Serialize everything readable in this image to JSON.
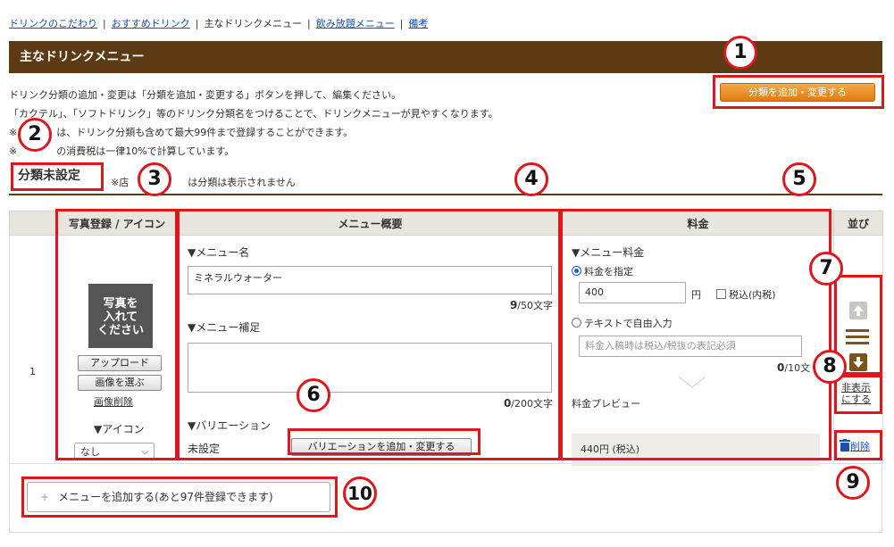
{
  "breadcrumb": {
    "items": [
      "ドリンクのこだわり",
      "おすすめドリンク",
      "主なドリンクメニュー",
      "飲み放題メニュー",
      "備考"
    ],
    "separator": "|"
  },
  "page_title": "主なドリンクメニュー",
  "description": {
    "line1": "ドリンク分類の追加・変更は「分類を追加・変更する」ボタンを押して、編集ください。",
    "line2": "「カクテル」、「ソフトドリンク」等のドリンク分類名をつけることで、ドリンクメニューが見やすくなります。",
    "line3": "※　　　　は、ドリンク分類も含めて最大99件まで登録することができます。",
    "line4": "※　　　　の消費税は一律10%で計算しています。"
  },
  "add_category_button": "分類を追加・変更する",
  "category": {
    "label": "分類未設定",
    "note": "※店　　　　　　は分類は表示されません"
  },
  "table": {
    "headers": [
      "",
      "写真登録 / アイコン",
      "メニュー概要",
      "料金",
      "並び"
    ],
    "row": {
      "number": "1",
      "photo": {
        "placeholder_line1": "写真を",
        "placeholder_line2": "入れて",
        "placeholder_line3": "ください",
        "upload_button": "アップロード",
        "choose_button": "画像を選ぶ",
        "delete_link": "画像削除",
        "icon_label": "▼アイコン",
        "icon_select_value": "なし"
      },
      "overview": {
        "name_label": "▼メニュー名",
        "name_value": "ミネラルウォーター",
        "name_count": "9",
        "name_limit": "/50文字",
        "supplement_label": "▼メニュー補足",
        "supplement_value": "",
        "supplement_count": "0",
        "supplement_limit": "/200文字",
        "variation_label": "▼バリエーション",
        "variation_status": "未設定",
        "variation_button": "バリエーションを追加・変更する"
      },
      "price": {
        "section_label": "▼メニュー料金",
        "radio_specify_label": "料金を指定",
        "price_value": "400",
        "yen": "円",
        "tax_included_label": "税込(内税)",
        "radio_free_label": "テキストで自由入力",
        "free_text_placeholder": "料金入稿時は税込/税抜の表記必須",
        "free_text_count": "0",
        "free_text_limit": "/10文",
        "preview_label": "料金プレビュー",
        "preview_value": "440円 (税込)"
      },
      "sort": {
        "hide_link_line1": "非表示",
        "hide_link_line2": "にする",
        "delete_link": "削除"
      }
    }
  },
  "add_menu_button": {
    "plus": "+",
    "label": "メニューを追加する(あと97件登録できます)"
  },
  "callouts": [
    "1",
    "2",
    "3",
    "4",
    "5",
    "6",
    "7",
    "8",
    "9",
    "10"
  ],
  "colors": {
    "title_bar": "#5c3a14",
    "annotation_red": "#e0161c",
    "orange_button": "#df7b0f"
  }
}
